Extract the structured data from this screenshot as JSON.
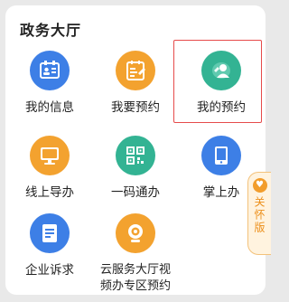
{
  "section": {
    "title": "政务大厅"
  },
  "tiles": [
    {
      "label": "我的信息",
      "icon": "id-card-icon",
      "color": "#3d7fe6"
    },
    {
      "label": "我要预约",
      "icon": "calendar-form-icon",
      "color": "#f3a22f"
    },
    {
      "label": "我的预约",
      "icon": "person-pin-icon",
      "color": "#33b393",
      "selected": true
    },
    {
      "label": "线上导办",
      "icon": "monitor-icon",
      "color": "#f3a22f"
    },
    {
      "label": "一码通办",
      "icon": "qr-code-icon",
      "color": "#33b393"
    },
    {
      "label": "掌上办",
      "icon": "tablet-icon",
      "color": "#3d7fe6"
    },
    {
      "label": "企业诉求",
      "icon": "document-list-icon",
      "color": "#3d7fe6"
    },
    {
      "label_line1": "云服务大厅视",
      "label_line2": "频办专区预约",
      "icon": "webcam-icon",
      "color": "#f3a22f"
    }
  ],
  "care_mode": {
    "label": "关怀版",
    "icon": "heart-icon",
    "color": "#f29d2c"
  }
}
